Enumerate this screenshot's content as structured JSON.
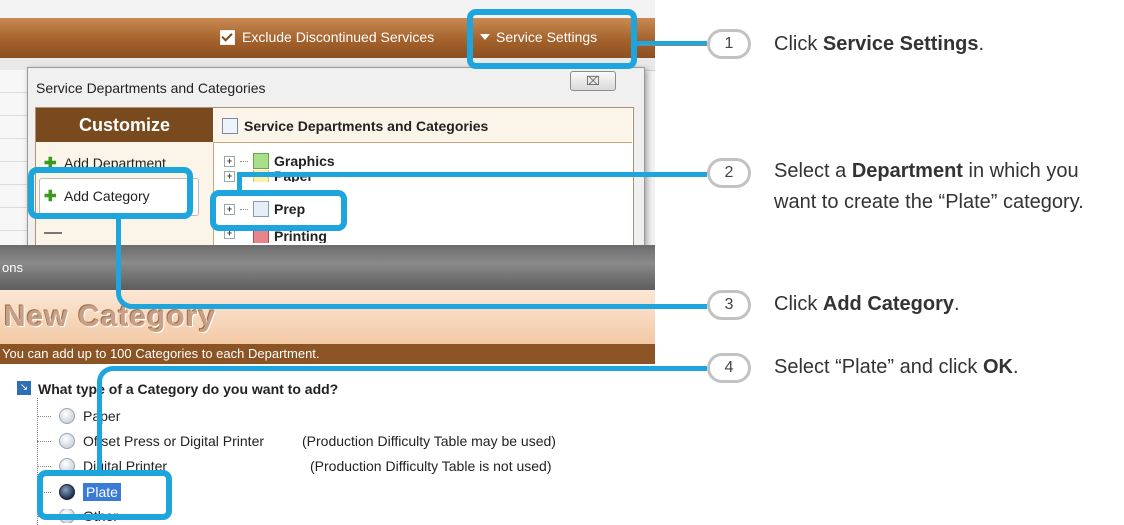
{
  "toolbar": {
    "exclude_label": "Exclude Discontinued Services",
    "settings_label": "Service Settings"
  },
  "dialog": {
    "title": "Service Departments and Categories",
    "close": "⌧",
    "customize_header": "Customize",
    "add_department": "Add Department",
    "add_category": "Add Category",
    "tree_header": "Service Departments and Categories",
    "departments": [
      "Graphics",
      "Paper",
      "Prep",
      "Printing"
    ]
  },
  "band": {
    "partial_label": "ons"
  },
  "new_category": {
    "title": "New Category",
    "info": "You can add up to 100 Categories to each Department.",
    "question": "What type of a Category do you want to add?",
    "options": [
      {
        "label": "Paper",
        "note": ""
      },
      {
        "label": "Offset Press or Digital Printer",
        "note": "(Production Difficulty Table may be used)"
      },
      {
        "label": "Digital Printer",
        "note": "(Production Difficulty Table is not used)"
      },
      {
        "label": "Plate",
        "note": ""
      },
      {
        "label": "Other",
        "note": ""
      }
    ]
  },
  "steps": [
    {
      "num": "1",
      "pre": "Click ",
      "bold": "Service Settings",
      "post": "."
    },
    {
      "num": "2",
      "pre": "Select a ",
      "bold": "Department",
      "post": " in which you want to create the “Plate” category."
    },
    {
      "num": "3",
      "pre": "Click ",
      "bold": "Add Category",
      "post": "."
    },
    {
      "num": "4",
      "pre": "Select “Plate” and click ",
      "bold": "OK",
      "post": "."
    }
  ],
  "colors": {
    "highlight": "#1ea5de",
    "toolbar": "#a4622c",
    "header_brown": "#7a4a1f"
  }
}
